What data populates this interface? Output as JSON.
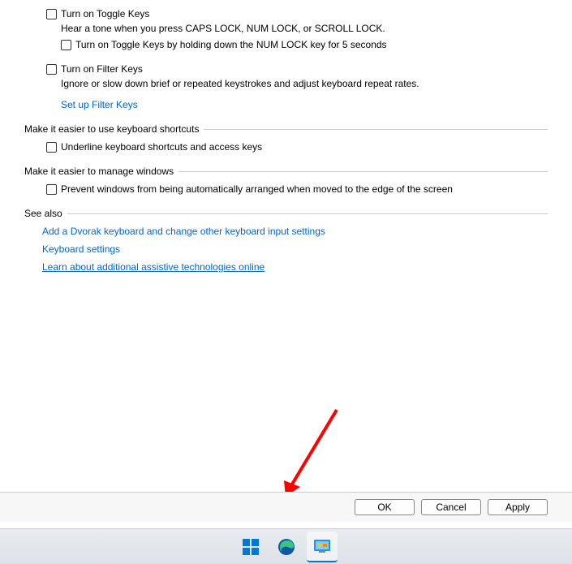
{
  "toggleKeys": {
    "label": "Turn on Toggle Keys",
    "desc": "Hear a tone when you press CAPS LOCK, NUM LOCK, or SCROLL LOCK.",
    "nestedLabel": "Turn on Toggle Keys by holding down the NUM LOCK key for 5 seconds"
  },
  "filterKeys": {
    "label": "Turn on Filter Keys",
    "desc": "Ignore or slow down brief or repeated keystrokes and adjust keyboard repeat rates.",
    "link": "Set up Filter Keys"
  },
  "sections": {
    "shortcuts": {
      "title": "Make it easier to use keyboard shortcuts",
      "checkbox": "Underline keyboard shortcuts and access keys"
    },
    "windows": {
      "title": "Make it easier to manage windows",
      "checkbox": "Prevent windows from being automatically arranged when moved to the edge of the screen"
    },
    "seeAlso": {
      "title": "See also",
      "links": [
        "Add a Dvorak keyboard and change other keyboard input settings",
        "Keyboard settings",
        "Learn about additional assistive technologies online"
      ]
    }
  },
  "buttons": {
    "ok": "OK",
    "cancel": "Cancel",
    "apply": "Apply"
  }
}
